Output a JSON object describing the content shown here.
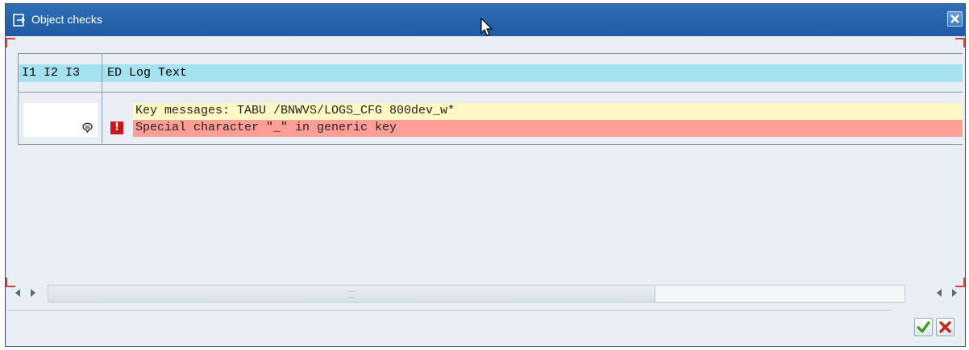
{
  "dialog": {
    "title": "Object checks",
    "icons": {
      "title": "dialog-edit-icon",
      "close": "close-icon",
      "cursor": "mouse-pointer"
    }
  },
  "table": {
    "headers": {
      "left": "I1 I2 I3",
      "right": "ED Log Text"
    },
    "rows": [
      {
        "text": "Key messages: TABU /BNWVS/LOGS_CFG 800dev_w*",
        "icon": "",
        "color": "#fff8c4"
      },
      {
        "text": "Special character \"_\" in generic key",
        "icon": "error-icon",
        "color": "#ff9e96",
        "left_icon": "speech-bubble-icon"
      }
    ],
    "colors": {
      "header": "#a4e2f0"
    }
  },
  "footer": {
    "buttons": [
      {
        "name": "confirm",
        "icon": "green-checkmark-icon"
      },
      {
        "name": "cancel",
        "icon": "red-x-icon"
      }
    ]
  }
}
